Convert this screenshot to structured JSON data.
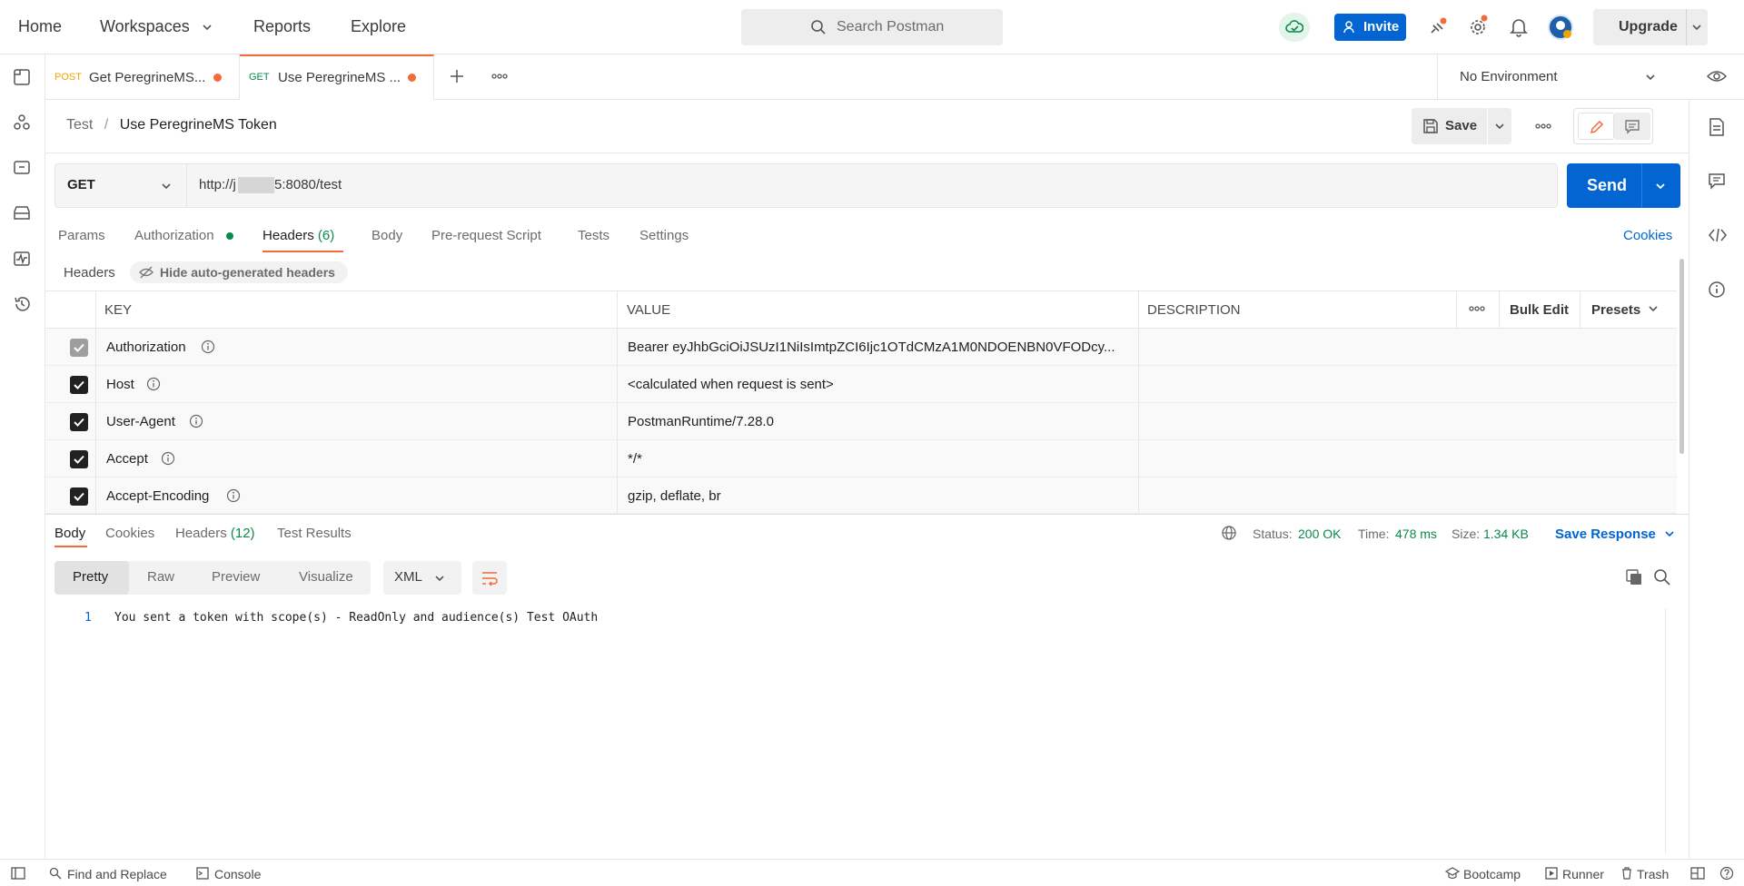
{
  "topbar": {
    "nav": [
      "Home",
      "Workspaces",
      "Reports",
      "Explore"
    ],
    "search_placeholder": "Search Postman",
    "invite_label": "Invite",
    "upgrade_label": "Upgrade"
  },
  "tabs": [
    {
      "method": "POST",
      "name": "Get PeregrineMS...",
      "method_color": "#f0a400"
    },
    {
      "method": "GET",
      "name": "Use PeregrineMS ...",
      "method_color": "#0a8a4a"
    }
  ],
  "environment": "No Environment",
  "breadcrumb": {
    "parent": "Test",
    "separator": "/",
    "current": "Use PeregrineMS Token"
  },
  "toolbar": {
    "save_label": "Save"
  },
  "request": {
    "method": "GET",
    "url_prefix": "http://j",
    "url_suffix": "5:8080/test",
    "send_label": "Send"
  },
  "request_tabs": {
    "params": "Params",
    "authorization": "Authorization",
    "headers": "Headers",
    "headers_count": "(6)",
    "body": "Body",
    "prerequest": "Pre-request Script",
    "tests": "Tests",
    "settings": "Settings",
    "cookies": "Cookies"
  },
  "headers_section": {
    "label": "Headers",
    "toggle_label": "Hide auto-generated headers"
  },
  "table": {
    "col_key": "KEY",
    "col_value": "VALUE",
    "col_description": "DESCRIPTION",
    "bulk_edit": "Bulk Edit",
    "presets": "Presets",
    "rows": [
      {
        "key": "Authorization",
        "value": "Bearer eyJhbGciOiJSUzI1NiIsImtpZCI6Ijc1OTdCMzA1M0NDOENBN0VFODcy..."
      },
      {
        "key": "Host",
        "value": "<calculated when request is sent>"
      },
      {
        "key": "User-Agent",
        "value": "PostmanRuntime/7.28.0"
      },
      {
        "key": "Accept",
        "value": "*/*"
      },
      {
        "key": "Accept-Encoding",
        "value": "gzip, deflate, br"
      }
    ]
  },
  "response": {
    "tabs": {
      "body": "Body",
      "cookies": "Cookies",
      "headers": "Headers",
      "headers_count": "(12)",
      "test_results": "Test Results"
    },
    "status_label": "Status:",
    "status_value": "200 OK",
    "time_label": "Time:",
    "time_value": "478 ms",
    "size_label": "Size:",
    "size_value": "1.34 KB",
    "save_response": "Save Response",
    "view_modes": [
      "Pretty",
      "Raw",
      "Preview",
      "Visualize"
    ],
    "format": "XML",
    "line_number": "1",
    "body_text": "You sent a token with scope(s) - ReadOnly and audience(s) Test OAuth"
  },
  "statusbar": {
    "find_replace": "Find and Replace",
    "console": "Console",
    "bootcamp": "Bootcamp",
    "runner": "Runner",
    "trash": "Trash"
  },
  "colors": {
    "accent": "#0265d2",
    "orange": "#f26b3a",
    "green": "#0a8a4a"
  }
}
